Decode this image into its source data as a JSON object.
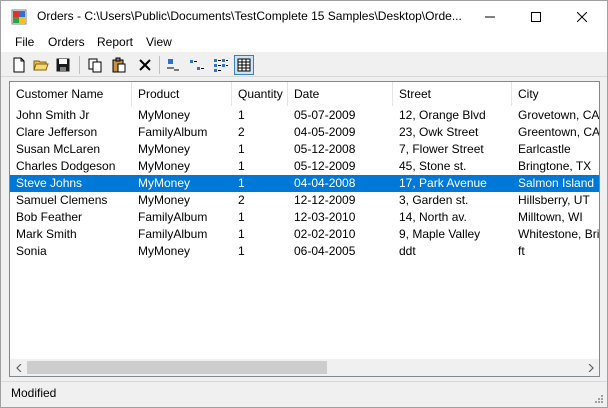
{
  "window": {
    "title": "Orders - C:\\Users\\Public\\Documents\\TestComplete 15 Samples\\Desktop\\Orde..."
  },
  "menu": [
    "File",
    "Orders",
    "Report",
    "View"
  ],
  "toolbar": {
    "buttons": [
      "new-file-icon",
      "open-folder-icon",
      "save-icon",
      "copy-icon",
      "paste-icon",
      "delete-icon",
      "large-icons-icon",
      "small-icons-icon",
      "list-view-icon",
      "details-view-icon"
    ],
    "active": "details-view-icon"
  },
  "table": {
    "columns": [
      "Customer Name",
      "Product",
      "Quantity",
      "Date",
      "Street",
      "City"
    ],
    "rows": [
      [
        "John Smith Jr",
        "MyMoney",
        "1",
        "05-07-2009",
        "12, Orange Blvd",
        "Grovetown, CA"
      ],
      [
        "Clare Jefferson",
        "FamilyAlbum",
        "2",
        "04-05-2009",
        "23, Owk Street",
        "Greentown, CA"
      ],
      [
        "Susan McLaren",
        "MyMoney",
        "1",
        "05-12-2008",
        "7, Flower Street",
        "Earlcastle"
      ],
      [
        "Charles Dodgeson",
        "MyMoney",
        "1",
        "05-12-2009",
        "45, Stone st.",
        "Bringtone, TX"
      ],
      [
        "Steve Johns",
        "MyMoney",
        "1",
        "04-04-2008",
        "17, Park Avenue",
        "Salmon Island"
      ],
      [
        "Samuel Clemens",
        "MyMoney",
        "2",
        "12-12-2009",
        "3, Garden st.",
        "Hillsberry, UT"
      ],
      [
        "Bob Feather",
        "FamilyAlbum",
        "1",
        "12-03-2010",
        "14, North av.",
        "Milltown, WI"
      ],
      [
        "Mark Smith",
        "FamilyAlbum",
        "1",
        "02-02-2010",
        "9, Maple Valley",
        "Whitestone, Britis"
      ],
      [
        "Sonia",
        "MyMoney",
        "1",
        "06-04-2005",
        "ddt",
        "ft"
      ]
    ],
    "selected_row": 4
  },
  "status": {
    "text": "Modified"
  },
  "colors": {
    "selection": "#0078d7",
    "window_bg": "#f0f0f0"
  }
}
